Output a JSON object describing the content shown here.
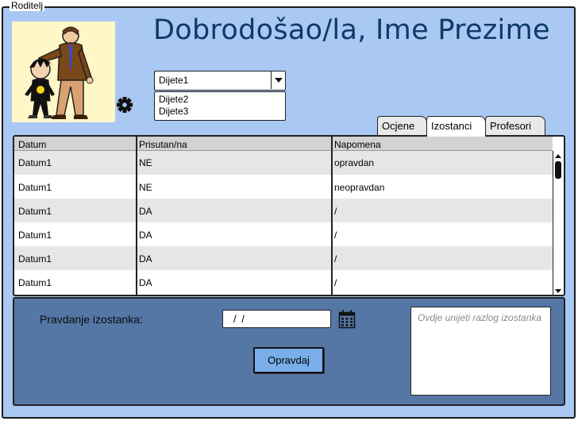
{
  "window": {
    "title": "Roditelj"
  },
  "header": {
    "welcome": "Dobrodošao/la, Ime Prezime"
  },
  "icons": {
    "settings": "gear-icon",
    "calendar": "calendar-icon",
    "avatar": "parent-child-illustration"
  },
  "child_selector": {
    "selected": "Dijete1",
    "options": [
      "Dijete2",
      "Dijete3"
    ]
  },
  "tabs": [
    {
      "label": "Ocjene",
      "active": false
    },
    {
      "label": "Izostanci",
      "active": true
    },
    {
      "label": "Profesori",
      "active": false
    }
  ],
  "table": {
    "columns": [
      "Datum",
      "Prisutan/na",
      "Napomena"
    ],
    "rows": [
      [
        "Datum1",
        "NE",
        "opravdan"
      ],
      [
        "Datum1",
        "NE",
        "neopravdan"
      ],
      [
        "Datum1",
        "DA",
        "/"
      ],
      [
        "Datum1",
        "DA",
        "/"
      ],
      [
        "Datum1",
        "DA",
        "/"
      ],
      [
        "Datum1",
        "DA",
        "/"
      ]
    ]
  },
  "justification": {
    "label": "Pravdanje izostanka:",
    "date_value": "/ /",
    "reason_placeholder": "Ovdje unijeti razlog izostanka",
    "submit_label": "Opravdaj"
  },
  "colors": {
    "background": "#a9c8f3",
    "title": "#0e3a66",
    "panel": "#5577a6",
    "button": "#7aaeea"
  }
}
